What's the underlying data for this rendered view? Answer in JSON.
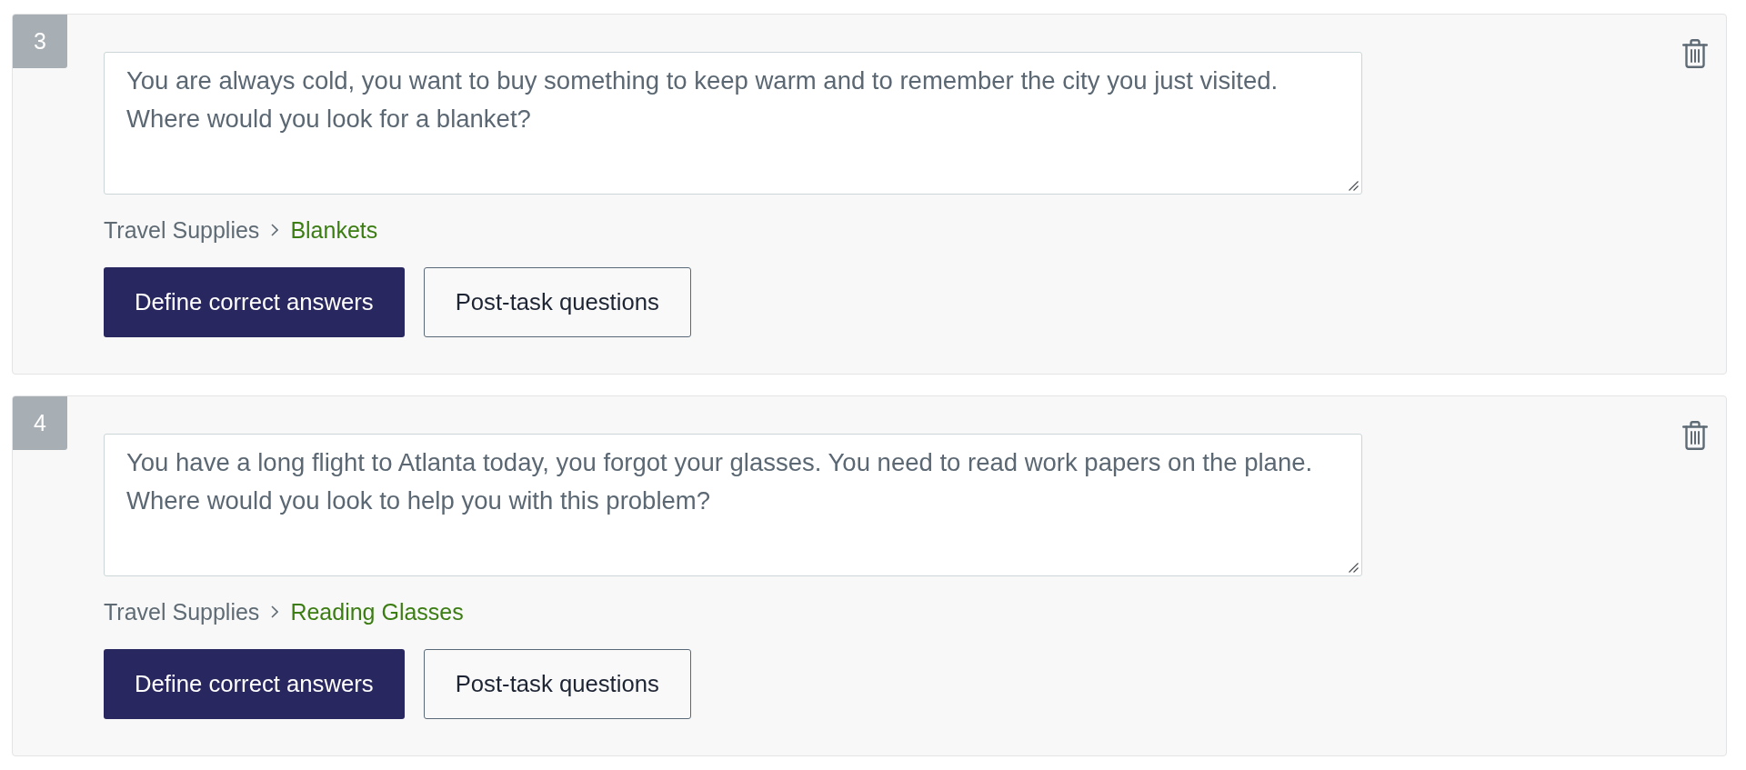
{
  "tasks": [
    {
      "number": "3",
      "description": "You are always cold, you want to buy something to keep warm and to remember the city you just visited.\nWhere would you look for a blanket?",
      "path": [
        "Travel Supplies",
        "Blankets"
      ],
      "buttons": [
        {
          "label": "Define correct answers",
          "kind": "primary"
        },
        {
          "label": "Post-task questions",
          "kind": "secondary"
        }
      ]
    },
    {
      "number": "4",
      "description": "You have a long flight to Atlanta today, you forgot your glasses. You need to read work papers on the plane.\nWhere would you look to help you with this problem?",
      "path": [
        "Travel Supplies",
        "Reading Glasses"
      ],
      "buttons": [
        {
          "label": "Define correct answers",
          "kind": "primary"
        },
        {
          "label": "Post-task questions",
          "kind": "secondary"
        }
      ]
    }
  ]
}
